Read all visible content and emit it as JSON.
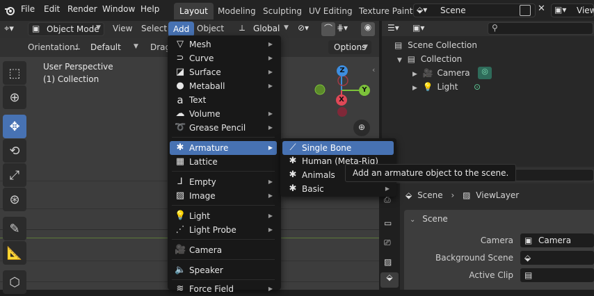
{
  "menubar": {
    "items": [
      "File",
      "Edit",
      "Render",
      "Window",
      "Help"
    ]
  },
  "workspaces": {
    "tabs": [
      "Layout",
      "Modeling",
      "Sculpting",
      "UV Editing",
      "Texture Paint"
    ],
    "active": "Layout"
  },
  "scene_selector": {
    "value": "Scene"
  },
  "viewlayer_selector": {
    "value": "View"
  },
  "viewport_header": {
    "mode": "Object Mode",
    "menus": [
      "View",
      "Select",
      "Add",
      "Object"
    ],
    "transform_orientation": "Global"
  },
  "viewport_sub": {
    "orientation_label": "Orientation:",
    "orientation_value": "Default",
    "drag_label": "Drag:",
    "options_label": "Options"
  },
  "viewport_overlay": {
    "view_name": "User Perspective",
    "collection": "(1) Collection"
  },
  "gizmo": {
    "z": "Z",
    "y": "Y",
    "x": "X"
  },
  "add_menu": {
    "items": [
      {
        "label": "Mesh",
        "icon": "mesh-icon",
        "submenu": true
      },
      {
        "label": "Curve",
        "icon": "curve-icon",
        "submenu": true
      },
      {
        "label": "Surface",
        "icon": "surface-icon",
        "submenu": true
      },
      {
        "label": "Metaball",
        "icon": "metaball-icon",
        "submenu": true
      },
      {
        "label": "Text",
        "icon": "text-icon",
        "submenu": false
      },
      {
        "label": "Volume",
        "icon": "volume-icon",
        "submenu": true
      },
      {
        "label": "Grease Pencil",
        "icon": "grease-pencil-icon",
        "submenu": true
      },
      {
        "label": "Armature",
        "icon": "armature-icon",
        "submenu": true,
        "highlighted": true
      },
      {
        "label": "Lattice",
        "icon": "lattice-icon",
        "submenu": false
      },
      {
        "label": "Empty",
        "icon": "empty-icon",
        "submenu": true
      },
      {
        "label": "Image",
        "icon": "image-icon",
        "submenu": true
      },
      {
        "label": "Light",
        "icon": "light-icon",
        "submenu": true
      },
      {
        "label": "Light Probe",
        "icon": "light-probe-icon",
        "submenu": true
      },
      {
        "label": "Camera",
        "icon": "camera-icon",
        "submenu": false
      },
      {
        "label": "Speaker",
        "icon": "speaker-icon",
        "submenu": false
      },
      {
        "label": "Force Field",
        "icon": "force-field-icon",
        "submenu": true
      }
    ]
  },
  "armature_submenu": {
    "items": [
      {
        "label": "Single Bone",
        "icon": "bone-icon",
        "highlighted": true
      },
      {
        "label": "Human (Meta-Rig)",
        "icon": "armature-icon"
      },
      {
        "label": "Animals",
        "icon": "armature-icon",
        "submenu": true
      },
      {
        "label": "Basic",
        "icon": "armature-icon",
        "submenu": true
      }
    ]
  },
  "tooltip": {
    "text": "Add an armature object to the scene."
  },
  "outliner": {
    "root": "Scene Collection",
    "collection": "Collection",
    "objects": [
      "Camera",
      "Light"
    ]
  },
  "properties": {
    "breadcrumb_scene": "Scene",
    "breadcrumb_viewlayer": "ViewLayer",
    "panel_title": "Scene",
    "rows": [
      {
        "label": "Camera",
        "value": "Camera"
      },
      {
        "label": "Background Scene",
        "value": ""
      },
      {
        "label": "Active Clip",
        "value": ""
      }
    ]
  },
  "colors": {
    "accent": "#4772b3",
    "gizmo_x": "#e04857",
    "gizmo_y": "#7cc23a",
    "gizmo_z": "#3d8ee0"
  }
}
